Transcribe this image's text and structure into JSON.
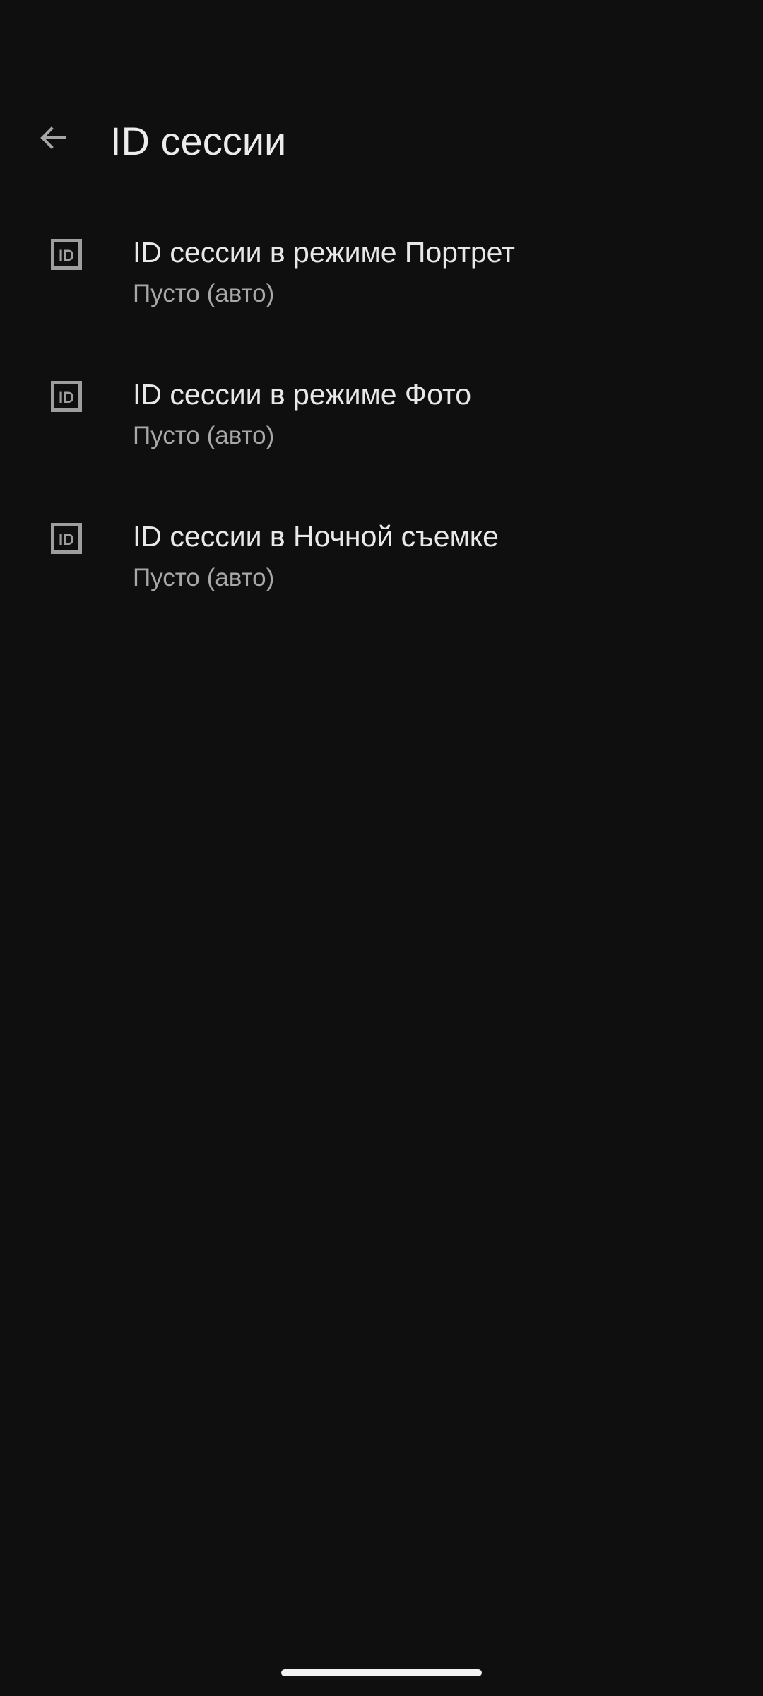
{
  "header": {
    "title": "ID сессии",
    "back_icon": "arrow-left-icon"
  },
  "items": [
    {
      "title": "ID сессии в режиме Портрет",
      "summary": "Пусто (авто)",
      "icon": "id-badge-icon"
    },
    {
      "title": "ID сессии в режиме Фото",
      "summary": "Пусто (авто)",
      "icon": "id-badge-icon"
    },
    {
      "title": "ID сессии в Ночной съемке",
      "summary": "Пусто (авто)",
      "icon": "id-badge-icon"
    }
  ],
  "colors": {
    "background": "#0f0f0f",
    "title_text": "#ececec",
    "summary_text": "#a8a8a8",
    "icon": "#9e9e9e"
  }
}
